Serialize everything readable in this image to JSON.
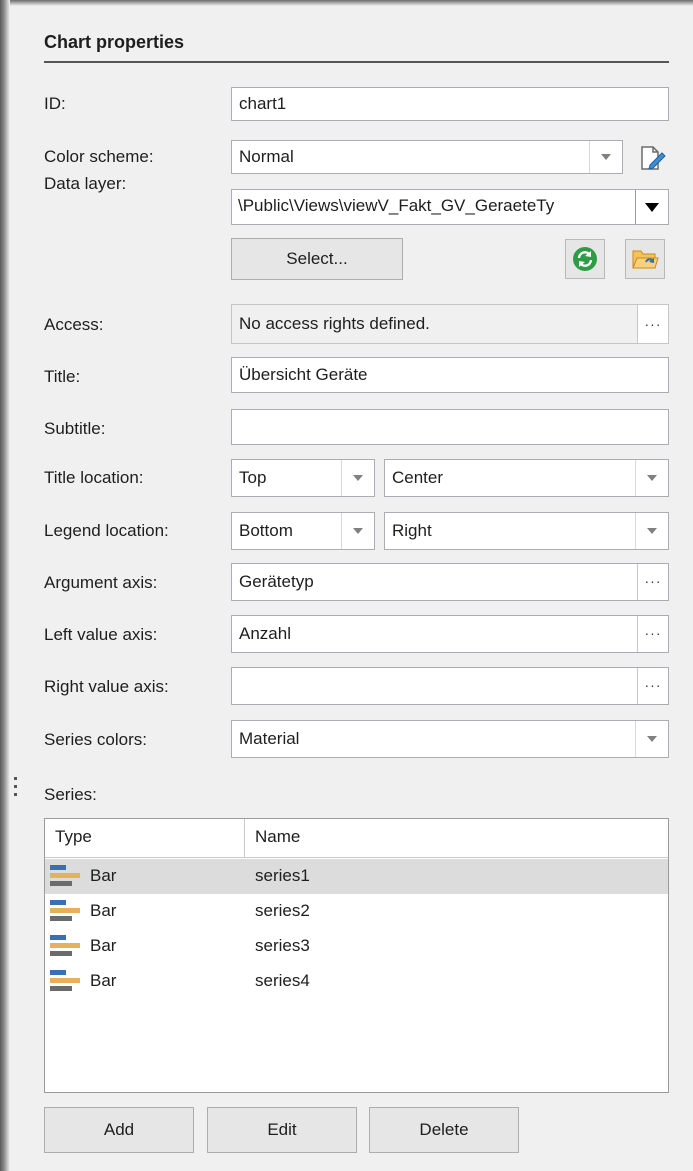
{
  "panel": {
    "header": "Chart properties"
  },
  "fields": {
    "id": {
      "label": "ID:",
      "value": "chart1"
    },
    "color_scheme": {
      "label": "Color scheme:",
      "value": "Normal"
    },
    "data_layer": {
      "label": "Data layer:",
      "value": "\\Public\\Views\\viewV_Fakt_GV_GeraeteTy"
    },
    "select_button": "Select...",
    "access": {
      "label": "Access:",
      "value": "No access rights defined."
    },
    "title": {
      "label": "Title:",
      "value": "Übersicht Geräte"
    },
    "subtitle": {
      "label": "Subtitle:",
      "value": ""
    },
    "title_location": {
      "label": "Title location:",
      "vertical": "Top",
      "horizontal": "Center"
    },
    "legend_location": {
      "label": "Legend location:",
      "vertical": "Bottom",
      "horizontal": "Right"
    },
    "argument_axis": {
      "label": "Argument axis:",
      "value": "Gerätetyp"
    },
    "left_value_axis": {
      "label": "Left value axis:",
      "value": "Anzahl"
    },
    "right_value_axis": {
      "label": "Right value axis:",
      "value": ""
    },
    "series_colors": {
      "label": "Series colors:",
      "value": "Material"
    },
    "dots": "···"
  },
  "series": {
    "label": "Series:",
    "columns": [
      "Type",
      "Name"
    ],
    "rows": [
      {
        "type": "Bar",
        "name": "series1",
        "selected": true
      },
      {
        "type": "Bar",
        "name": "series2",
        "selected": false
      },
      {
        "type": "Bar",
        "name": "series3",
        "selected": false
      },
      {
        "type": "Bar",
        "name": "series4",
        "selected": false
      }
    ]
  },
  "buttons": {
    "add": "Add",
    "edit": "Edit",
    "delete": "Delete"
  },
  "icons": {
    "edit": "edit-scheme-icon",
    "refresh": "refresh-icon",
    "folder": "open-folder-icon",
    "bar": "bar-chart-icon"
  },
  "colors": {
    "refresh_green": "#2e9c45",
    "folder_orange": "#e8a33a",
    "bar_blue": "#3a6fb5",
    "bar_orange": "#e8b05a",
    "bar_gray": "#6b6b6b"
  }
}
